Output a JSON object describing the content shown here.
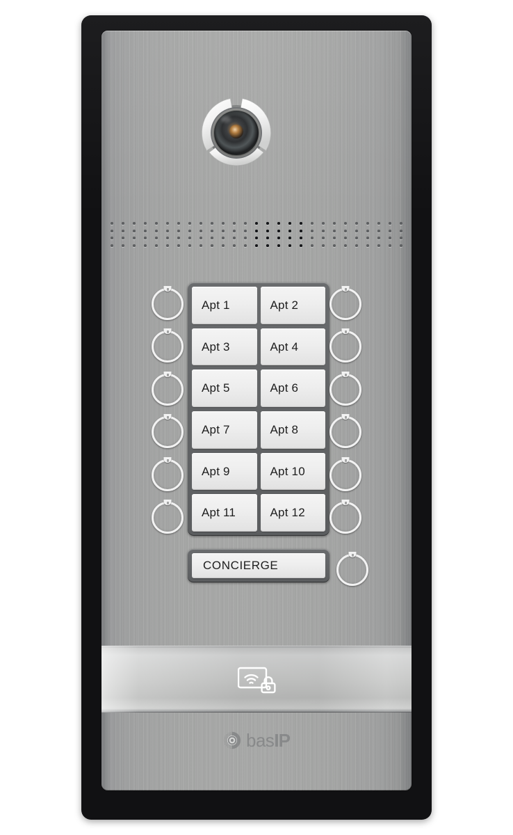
{
  "device": {
    "brand": "bas IP",
    "brand_bas": "bas",
    "brand_ip": "IP",
    "type": "multi-apartment-video-door-station"
  },
  "camera": {
    "label": "camera-lens"
  },
  "speaker": {
    "label": "speaker-grille",
    "rows": 4,
    "columns": 27,
    "dark_columns": [
      13,
      14,
      15,
      16,
      17
    ]
  },
  "call_panel": {
    "rows": [
      {
        "left": {
          "label": "Apt 1"
        },
        "right": {
          "label": "Apt 2"
        }
      },
      {
        "left": {
          "label": "Apt 3"
        },
        "right": {
          "label": "Apt 4"
        }
      },
      {
        "left": {
          "label": "Apt 5"
        },
        "right": {
          "label": "Apt 6"
        }
      },
      {
        "left": {
          "label": "Apt 7"
        },
        "right": {
          "label": "Apt 8"
        }
      },
      {
        "left": {
          "label": "Apt 9"
        },
        "right": {
          "label": "Apt 10"
        }
      },
      {
        "left": {
          "label": "Apt 11"
        },
        "right": {
          "label": "Apt 12"
        }
      }
    ]
  },
  "concierge": {
    "label": "CONCIERGE"
  },
  "rfid": {
    "icon": "rfid-card-lock-icon",
    "led": "status-led"
  },
  "colors": {
    "frame_black": "#111113",
    "panel_metal": "#a7a8a7",
    "plate_white": "#eeeeee",
    "plate_frame": "#626466",
    "rfid_strip": "#cdcecd",
    "text": "#1d1d1d",
    "logo": "#76787a",
    "led": "#3b3d3f"
  }
}
